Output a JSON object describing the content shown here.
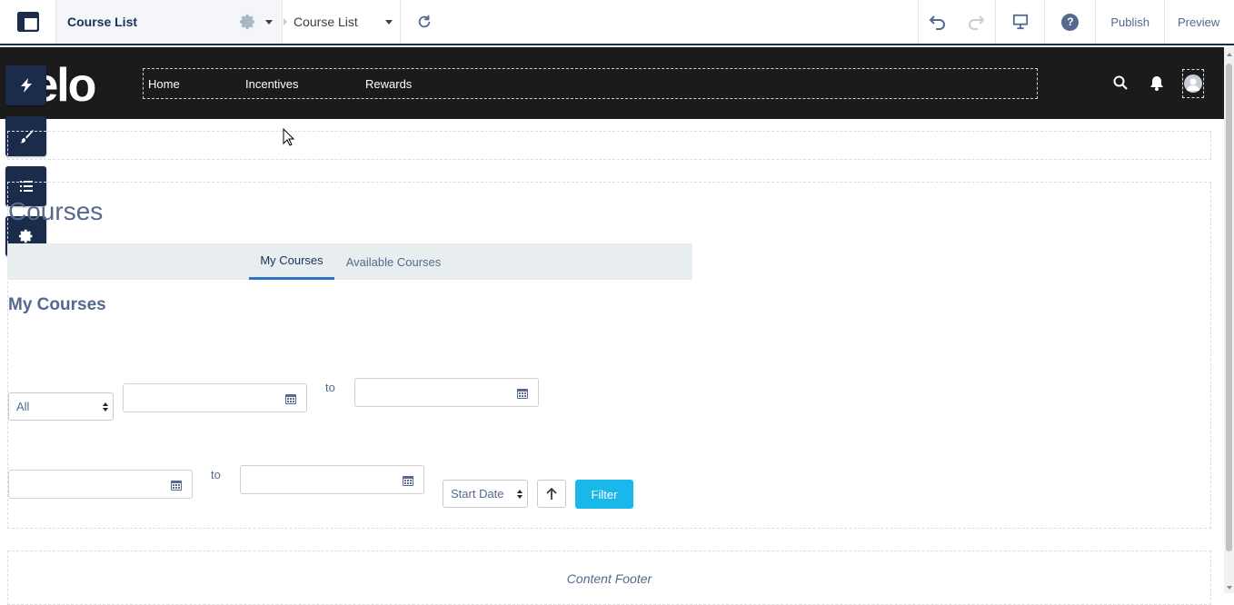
{
  "toolbar": {
    "page_name": "Course List",
    "breadcrumb_page": "Course List",
    "publish_label": "Publish",
    "preview_label": "Preview",
    "help_symbol": "?"
  },
  "header": {
    "logo_text": "felo",
    "nav_items": [
      "Home",
      "Incentives",
      "Rewards"
    ]
  },
  "side_tools": [
    "lightning-icon",
    "paintbrush-icon",
    "list-icon",
    "gear-icon"
  ],
  "main": {
    "page_title": "Courses",
    "tabs": [
      {
        "label": "My Courses",
        "active": true
      },
      {
        "label": "Available Courses",
        "active": false
      }
    ],
    "section_title": "My Courses",
    "status_select": "All",
    "to_label_1": "to",
    "to_label_2": "to",
    "sort_select": "Start Date",
    "filter_label": "Filter",
    "footer_text": "Content Footer"
  },
  "colors": {
    "header_bg": "#1b1b1b",
    "tool_bg": "#1b2b4b",
    "accent": "#1ab7ea",
    "tab_active": "#2e73c6"
  }
}
